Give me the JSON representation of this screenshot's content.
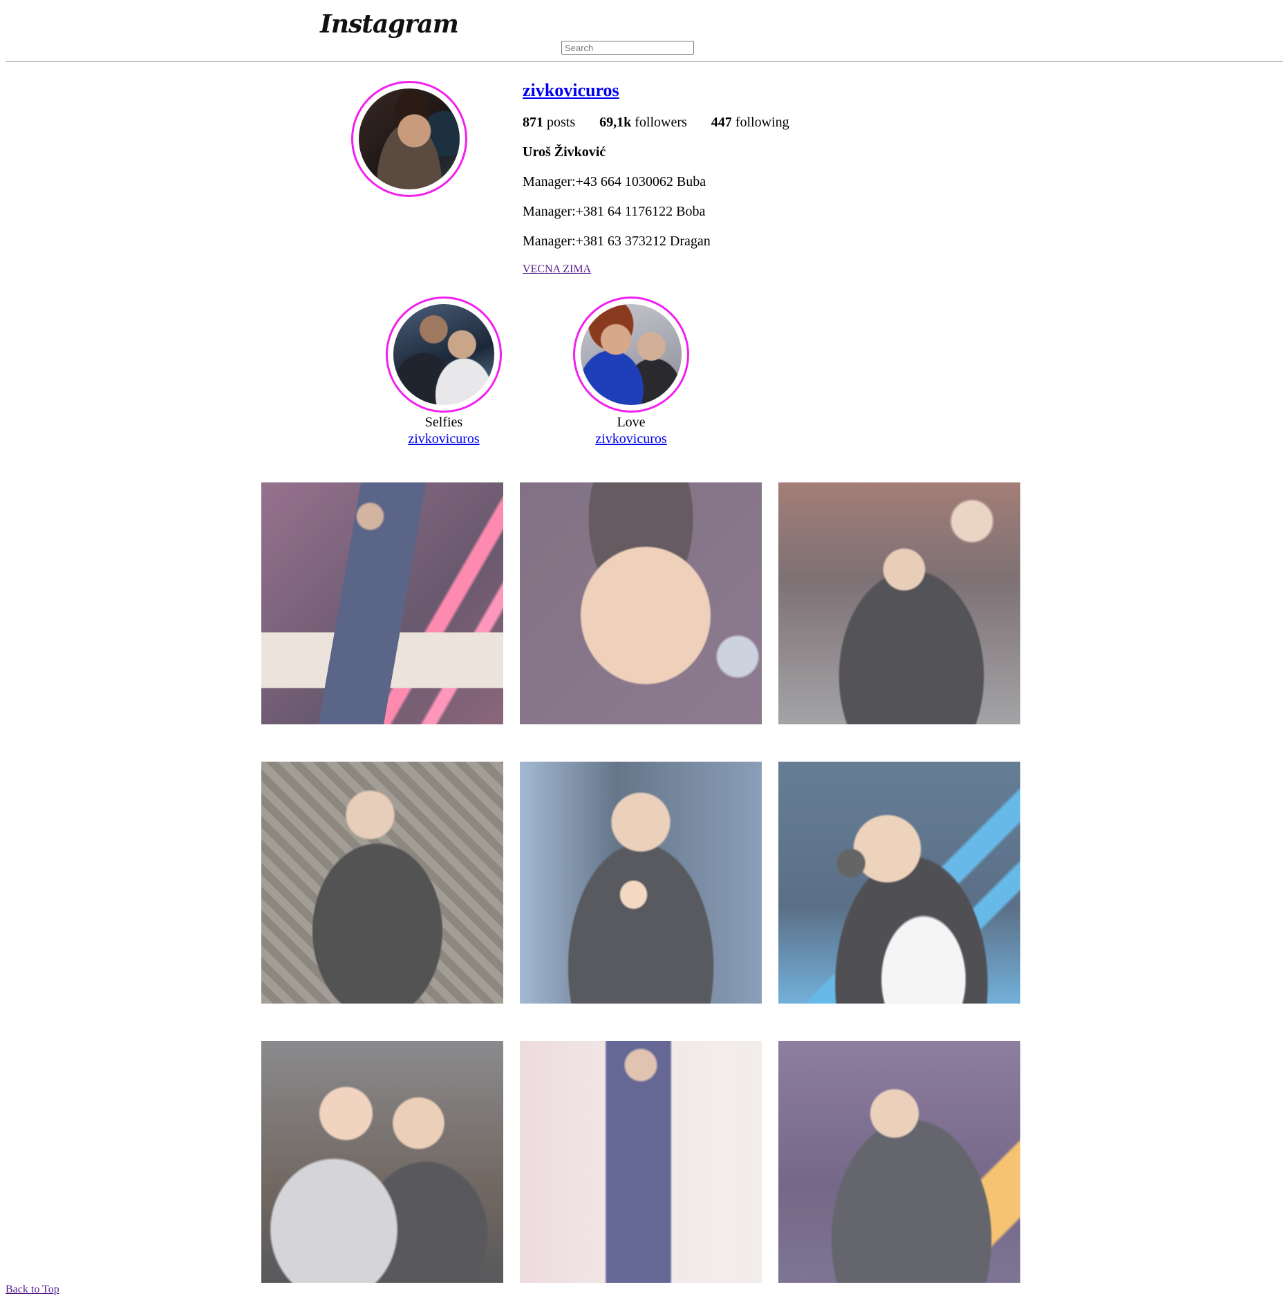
{
  "header": {
    "logo": "Instagram",
    "search_placeholder": "Search",
    "search_value": ""
  },
  "profile": {
    "username": "zivkovicuros",
    "stats": [
      {
        "count": "871",
        "label": "posts"
      },
      {
        "count": "69,1k",
        "label": "followers"
      },
      {
        "count": "447",
        "label": "following"
      }
    ],
    "full_name": "Uroš Živković",
    "bio": [
      "Manager:+43 664 1030062 Buba",
      "Manager:+381 64 1176122 Boba",
      "Manager:+381 63 373212 Dragan"
    ],
    "link": "VECNA ZIMA"
  },
  "highlights": [
    {
      "title": "Selfies",
      "user": "zivkovicuros"
    },
    {
      "title": "Love",
      "user": "zivkovicuros"
    }
  ],
  "posts": [
    {
      "icon": "photo-singer-stage"
    },
    {
      "icon": "photo-face-closeup"
    },
    {
      "icon": "photo-singing-band"
    },
    {
      "icon": "photo-leather-jacket"
    },
    {
      "icon": "photo-praying-hands"
    },
    {
      "icon": "photo-tv-stage"
    },
    {
      "icon": "photo-two-friends"
    },
    {
      "icon": "photo-mirror-suit"
    },
    {
      "icon": "photo-singer-gray-suit"
    }
  ],
  "footer": {
    "back_to_top": "Back to Top"
  },
  "colors": {
    "ring": "#f21ff2",
    "link": "#0000ee",
    "visited_link": "#551a8b"
  }
}
